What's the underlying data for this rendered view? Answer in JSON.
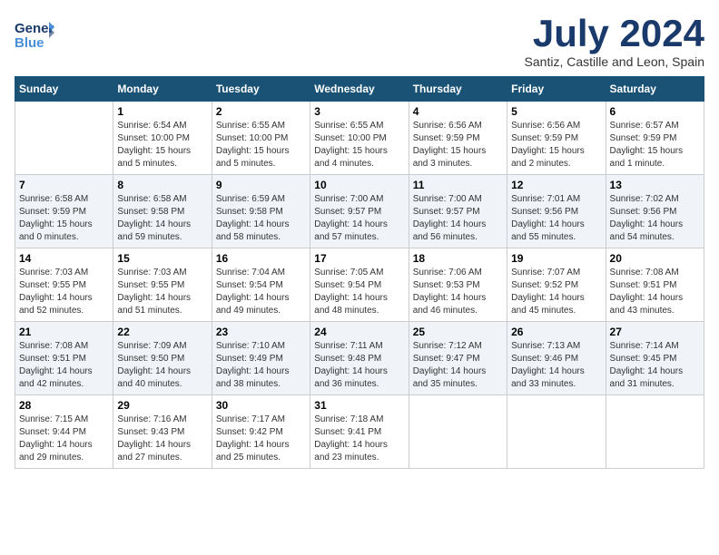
{
  "logo": {
    "line1": "General",
    "line2": "Blue"
  },
  "header": {
    "month": "July 2024",
    "location": "Santiz, Castille and Leon, Spain"
  },
  "weekdays": [
    "Sunday",
    "Monday",
    "Tuesday",
    "Wednesday",
    "Thursday",
    "Friday",
    "Saturday"
  ],
  "weeks": [
    [
      {
        "day": "",
        "sunrise": "",
        "sunset": "",
        "daylight": ""
      },
      {
        "day": "1",
        "sunrise": "Sunrise: 6:54 AM",
        "sunset": "Sunset: 10:00 PM",
        "daylight": "Daylight: 15 hours and 5 minutes."
      },
      {
        "day": "2",
        "sunrise": "Sunrise: 6:55 AM",
        "sunset": "Sunset: 10:00 PM",
        "daylight": "Daylight: 15 hours and 5 minutes."
      },
      {
        "day": "3",
        "sunrise": "Sunrise: 6:55 AM",
        "sunset": "Sunset: 10:00 PM",
        "daylight": "Daylight: 15 hours and 4 minutes."
      },
      {
        "day": "4",
        "sunrise": "Sunrise: 6:56 AM",
        "sunset": "Sunset: 9:59 PM",
        "daylight": "Daylight: 15 hours and 3 minutes."
      },
      {
        "day": "5",
        "sunrise": "Sunrise: 6:56 AM",
        "sunset": "Sunset: 9:59 PM",
        "daylight": "Daylight: 15 hours and 2 minutes."
      },
      {
        "day": "6",
        "sunrise": "Sunrise: 6:57 AM",
        "sunset": "Sunset: 9:59 PM",
        "daylight": "Daylight: 15 hours and 1 minute."
      }
    ],
    [
      {
        "day": "7",
        "sunrise": "Sunrise: 6:58 AM",
        "sunset": "Sunset: 9:59 PM",
        "daylight": "Daylight: 15 hours and 0 minutes."
      },
      {
        "day": "8",
        "sunrise": "Sunrise: 6:58 AM",
        "sunset": "Sunset: 9:58 PM",
        "daylight": "Daylight: 14 hours and 59 minutes."
      },
      {
        "day": "9",
        "sunrise": "Sunrise: 6:59 AM",
        "sunset": "Sunset: 9:58 PM",
        "daylight": "Daylight: 14 hours and 58 minutes."
      },
      {
        "day": "10",
        "sunrise": "Sunrise: 7:00 AM",
        "sunset": "Sunset: 9:57 PM",
        "daylight": "Daylight: 14 hours and 57 minutes."
      },
      {
        "day": "11",
        "sunrise": "Sunrise: 7:00 AM",
        "sunset": "Sunset: 9:57 PM",
        "daylight": "Daylight: 14 hours and 56 minutes."
      },
      {
        "day": "12",
        "sunrise": "Sunrise: 7:01 AM",
        "sunset": "Sunset: 9:56 PM",
        "daylight": "Daylight: 14 hours and 55 minutes."
      },
      {
        "day": "13",
        "sunrise": "Sunrise: 7:02 AM",
        "sunset": "Sunset: 9:56 PM",
        "daylight": "Daylight: 14 hours and 54 minutes."
      }
    ],
    [
      {
        "day": "14",
        "sunrise": "Sunrise: 7:03 AM",
        "sunset": "Sunset: 9:55 PM",
        "daylight": "Daylight: 14 hours and 52 minutes."
      },
      {
        "day": "15",
        "sunrise": "Sunrise: 7:03 AM",
        "sunset": "Sunset: 9:55 PM",
        "daylight": "Daylight: 14 hours and 51 minutes."
      },
      {
        "day": "16",
        "sunrise": "Sunrise: 7:04 AM",
        "sunset": "Sunset: 9:54 PM",
        "daylight": "Daylight: 14 hours and 49 minutes."
      },
      {
        "day": "17",
        "sunrise": "Sunrise: 7:05 AM",
        "sunset": "Sunset: 9:54 PM",
        "daylight": "Daylight: 14 hours and 48 minutes."
      },
      {
        "day": "18",
        "sunrise": "Sunrise: 7:06 AM",
        "sunset": "Sunset: 9:53 PM",
        "daylight": "Daylight: 14 hours and 46 minutes."
      },
      {
        "day": "19",
        "sunrise": "Sunrise: 7:07 AM",
        "sunset": "Sunset: 9:52 PM",
        "daylight": "Daylight: 14 hours and 45 minutes."
      },
      {
        "day": "20",
        "sunrise": "Sunrise: 7:08 AM",
        "sunset": "Sunset: 9:51 PM",
        "daylight": "Daylight: 14 hours and 43 minutes."
      }
    ],
    [
      {
        "day": "21",
        "sunrise": "Sunrise: 7:08 AM",
        "sunset": "Sunset: 9:51 PM",
        "daylight": "Daylight: 14 hours and 42 minutes."
      },
      {
        "day": "22",
        "sunrise": "Sunrise: 7:09 AM",
        "sunset": "Sunset: 9:50 PM",
        "daylight": "Daylight: 14 hours and 40 minutes."
      },
      {
        "day": "23",
        "sunrise": "Sunrise: 7:10 AM",
        "sunset": "Sunset: 9:49 PM",
        "daylight": "Daylight: 14 hours and 38 minutes."
      },
      {
        "day": "24",
        "sunrise": "Sunrise: 7:11 AM",
        "sunset": "Sunset: 9:48 PM",
        "daylight": "Daylight: 14 hours and 36 minutes."
      },
      {
        "day": "25",
        "sunrise": "Sunrise: 7:12 AM",
        "sunset": "Sunset: 9:47 PM",
        "daylight": "Daylight: 14 hours and 35 minutes."
      },
      {
        "day": "26",
        "sunrise": "Sunrise: 7:13 AM",
        "sunset": "Sunset: 9:46 PM",
        "daylight": "Daylight: 14 hours and 33 minutes."
      },
      {
        "day": "27",
        "sunrise": "Sunrise: 7:14 AM",
        "sunset": "Sunset: 9:45 PM",
        "daylight": "Daylight: 14 hours and 31 minutes."
      }
    ],
    [
      {
        "day": "28",
        "sunrise": "Sunrise: 7:15 AM",
        "sunset": "Sunset: 9:44 PM",
        "daylight": "Daylight: 14 hours and 29 minutes."
      },
      {
        "day": "29",
        "sunrise": "Sunrise: 7:16 AM",
        "sunset": "Sunset: 9:43 PM",
        "daylight": "Daylight: 14 hours and 27 minutes."
      },
      {
        "day": "30",
        "sunrise": "Sunrise: 7:17 AM",
        "sunset": "Sunset: 9:42 PM",
        "daylight": "Daylight: 14 hours and 25 minutes."
      },
      {
        "day": "31",
        "sunrise": "Sunrise: 7:18 AM",
        "sunset": "Sunset: 9:41 PM",
        "daylight": "Daylight: 14 hours and 23 minutes."
      },
      {
        "day": "",
        "sunrise": "",
        "sunset": "",
        "daylight": ""
      },
      {
        "day": "",
        "sunrise": "",
        "sunset": "",
        "daylight": ""
      },
      {
        "day": "",
        "sunrise": "",
        "sunset": "",
        "daylight": ""
      }
    ]
  ]
}
